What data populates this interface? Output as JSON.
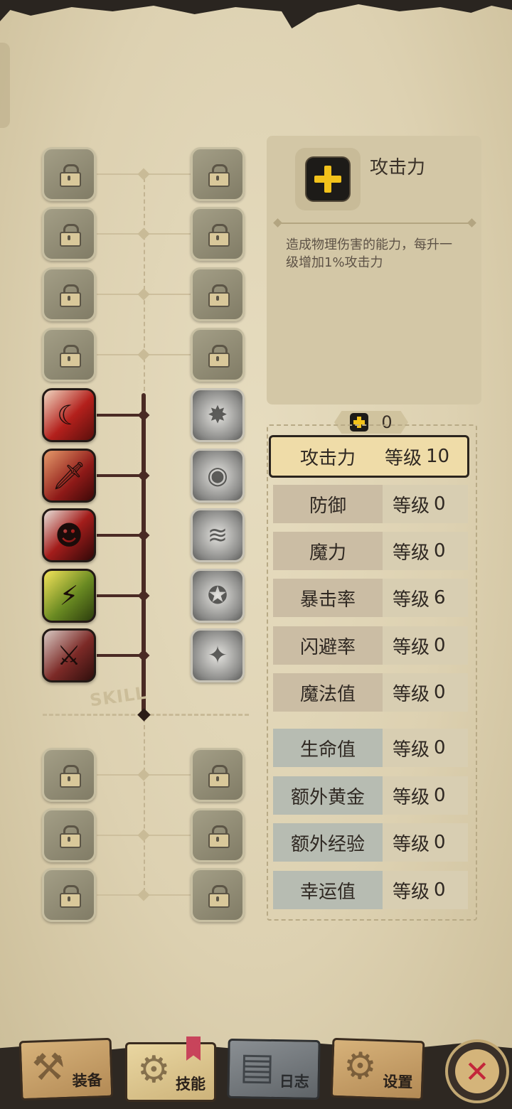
{
  "skill_tree": {
    "watermark": "SKILL",
    "locked_top_rows": 4,
    "unlocked_rows": 5,
    "locked_bottom_rows": 3,
    "left_icons": [
      "lock-icon",
      "lock-icon",
      "lock-icon",
      "lock-icon",
      "crescent-slash-icon",
      "dagger-icon",
      "ninja-mask-icon",
      "lightning-figure-icon",
      "crossed-swords-icon",
      "lock-icon",
      "lock-icon",
      "lock-icon"
    ],
    "right_icons": [
      "lock-icon",
      "lock-icon",
      "lock-icon",
      "lock-icon",
      "burst-figure-icon",
      "eye-burst-icon",
      "wind-blade-icon",
      "orb-shield-icon",
      "sparkle-figure-icon",
      "lock-icon",
      "lock-icon",
      "lock-icon"
    ],
    "left_glyphs": [
      "",
      "",
      "",
      "",
      "☾",
      "🗡",
      "☻",
      "⚡",
      "⚔",
      "",
      "",
      ""
    ],
    "right_glyphs": [
      "",
      "",
      "",
      "",
      "✸",
      "◉",
      "≋",
      "✪",
      "✦",
      "",
      "",
      ""
    ]
  },
  "info": {
    "title": "攻击力",
    "description": "造成物理伤害的能力，每升一级增加1%攻击力",
    "icon": "plus-icon"
  },
  "points": {
    "value": "0",
    "icon": "plus-icon"
  },
  "stats": [
    {
      "name": "攻击力",
      "level_label": "等级",
      "level": "10",
      "selected": true,
      "group": "warm"
    },
    {
      "name": "防御",
      "level_label": "等级",
      "level": "0",
      "selected": false,
      "group": "warm"
    },
    {
      "name": "魔力",
      "level_label": "等级",
      "level": "0",
      "selected": false,
      "group": "warm"
    },
    {
      "name": "暴击率",
      "level_label": "等级",
      "level": "6",
      "selected": false,
      "group": "warm"
    },
    {
      "name": "闪避率",
      "level_label": "等级",
      "level": "0",
      "selected": false,
      "group": "warm"
    },
    {
      "name": "魔法值",
      "level_label": "等级",
      "level": "0",
      "selected": false,
      "group": "warm"
    },
    {
      "name": "生命值",
      "level_label": "等级",
      "level": "0",
      "selected": false,
      "group": "cool"
    },
    {
      "name": "额外黄金",
      "level_label": "等级",
      "level": "0",
      "selected": false,
      "group": "cool"
    },
    {
      "name": "额外经验",
      "level_label": "等级",
      "level": "0",
      "selected": false,
      "group": "cool"
    },
    {
      "name": "幸运值",
      "level_label": "等级",
      "level": "0",
      "selected": false,
      "group": "cool"
    }
  ],
  "bottom_nav": {
    "tabs": [
      {
        "label": "装备",
        "icon": "axe-icon",
        "active": false
      },
      {
        "label": "技能",
        "icon": "skill-gear-icon",
        "active": true
      },
      {
        "label": "日志",
        "icon": "journal-icon",
        "active": false
      },
      {
        "label": "设置",
        "icon": "gear-icon",
        "active": false
      }
    ],
    "close_icon": "close-icon",
    "close_glyph": "✕"
  },
  "colors": {
    "accent_plus": "#f2c21b",
    "active_branch": "#4a2a24",
    "close_x": "#c3263a"
  }
}
